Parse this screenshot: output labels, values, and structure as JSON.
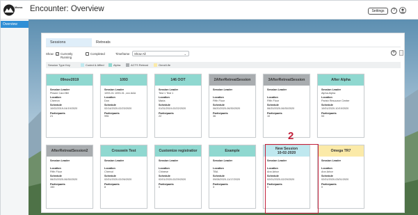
{
  "header": {
    "logo_text": "Mama",
    "title": "Encounter: Overview",
    "settings_label": "Settings",
    "help_label": "?"
  },
  "nav": {
    "items": [
      {
        "label": "Overview"
      }
    ]
  },
  "tabs": [
    {
      "label": "Sessions"
    },
    {
      "label": "Retreats"
    }
  ],
  "filters": {
    "show_label": "Show",
    "currently_running": "Currently Running",
    "completed": "Completed",
    "timeframe_label": "Timeframe",
    "timeframe_value": "Show All"
  },
  "legend": {
    "label": "Session Type Key",
    "items": [
      {
        "label": "Coded & Affied",
        "color": "#bfe8ef"
      },
      {
        "label": "Alpha",
        "color": "#8fd8d0"
      },
      {
        "label": "ACTS Retreat",
        "color": "#a9adb0"
      },
      {
        "label": "Omni/Life",
        "color": "#fbeaa8"
      }
    ]
  },
  "card_labels": {
    "leader": "Session Leader",
    "location": "Location",
    "schedule": "Schedule",
    "participants": "Participants"
  },
  "cards": [
    {
      "title": "09nov2019",
      "title2": "",
      "color": "#8fd8d0",
      "leader": "Pixsee Card Bill",
      "location": "Cherron",
      "schedule": "10/02/2019-04/19/2020",
      "participants": "21"
    },
    {
      "title": "1093",
      "title2": "",
      "color": "#8fd8d0",
      "leader": "1093-01 1093-01 ,xxx AAA",
      "location": "Don",
      "schedule": "02/14/2020-02/23/2020",
      "participants": "996"
    },
    {
      "title": "146 OOT",
      "title2": "",
      "color": "#8fd8d0",
      "leader": "Test 1 Test 1",
      "location": "Marla",
      "schedule": "01/31/2019-02/22/2020",
      "participants": "22"
    },
    {
      "title": "2AfterRetreatSession",
      "title2": "",
      "color": "#a9adb0",
      "leader": "",
      "location": "Fifth Floor",
      "schedule": "06/20/2020-06/30/2020",
      "participants": "36"
    },
    {
      "title": "3AfterRetreatSession",
      "title2": "",
      "color": "#a9adb0",
      "leader": "",
      "location": "Fifth Floor",
      "schedule": "06/20/2020-06/30/2020",
      "participants": "10"
    },
    {
      "title": "After Alpha",
      "title2": "",
      "color": "#8fd8d0",
      "leader": "Alpha Alpha",
      "location": "Parish Resource Center",
      "schedule": "10/01/2020-10/19/2020",
      "participants": "53"
    },
    {
      "title": "AfterRetreatSession2",
      "title2": "",
      "color": "#a9adb0",
      "leader": "",
      "location": "Fifth Floor",
      "schedule": "06/20/2020-06/30/2020",
      "participants": "150"
    },
    {
      "title": "Crosswin Test",
      "title2": "",
      "color": "#8fd8d0",
      "leader": "",
      "location": "Chervol",
      "schedule": "02/01/2020-02/26/2020",
      "participants": "8"
    },
    {
      "title": "Customize registratior",
      "title2": "",
      "color": "#8fd8d0",
      "leader": "",
      "location": "Chinese",
      "schedule": "02/01/2020-02/29/2020",
      "participants": "0"
    },
    {
      "title": "Example",
      "title2": "",
      "color": "#8fd8d0",
      "leader": "",
      "location": "TBA",
      "schedule": "09/08/2020-11/17/2020",
      "participants": "3"
    },
    {
      "title": "New Session",
      "title2": "10-02-2020",
      "color": "#bfe8ef",
      "leader": "",
      "location": "Ann Arbor",
      "schedule": "02/01/2020-02/29/2020",
      "participants": "0"
    },
    {
      "title": "Omega TR7",
      "title2": "",
      "color": "#fbeaa8",
      "leader": "",
      "location": "Ann Arbor",
      "schedule": "02/01/2020-03/01/2020",
      "participants": "0"
    }
  ],
  "annotation": {
    "number": "2"
  }
}
